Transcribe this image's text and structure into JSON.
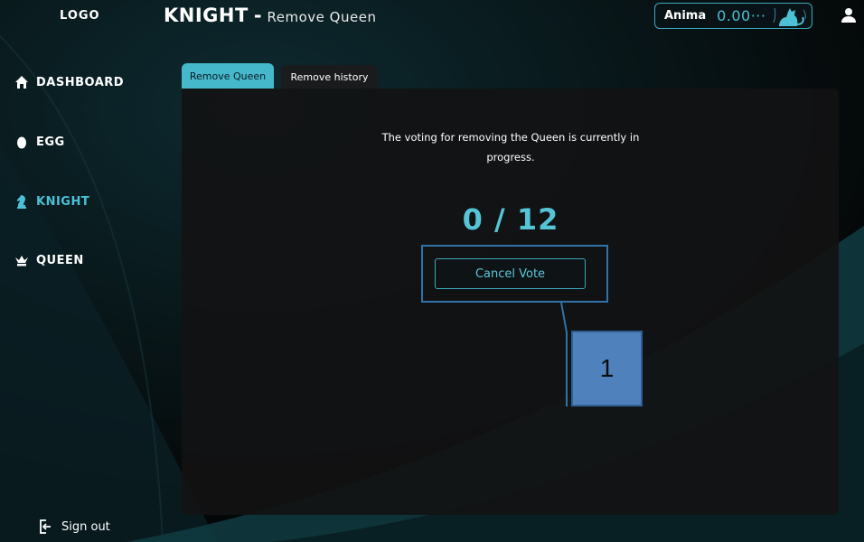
{
  "sidebar": {
    "logo": "LOGO",
    "items": [
      {
        "label": "DASHBOARD",
        "icon": "home-icon"
      },
      {
        "label": "EGG",
        "icon": "egg-icon"
      },
      {
        "label": "KNIGHT",
        "icon": "knight-icon",
        "active": true
      },
      {
        "label": "QUEEN",
        "icon": "crown-icon"
      }
    ],
    "sign_out": "Sign out"
  },
  "header": {
    "title": "KNIGHT",
    "separator": "-",
    "subtitle": "Remove Queen",
    "anima_label": "Anima",
    "anima_value": "0.00···"
  },
  "tabs": [
    {
      "label": "Remove Queen",
      "active": true
    },
    {
      "label": "Remove history",
      "active": false
    }
  ],
  "main": {
    "message": "The voting for removing the Queen is currently in progress.",
    "vote_count": "0 / 12",
    "cancel_label": "Cancel Vote"
  },
  "annotation": {
    "label": "1"
  },
  "colors": {
    "accent": "#45b8cc",
    "background": "#050607",
    "panel": "#121214",
    "callout": "#4f81bd"
  }
}
